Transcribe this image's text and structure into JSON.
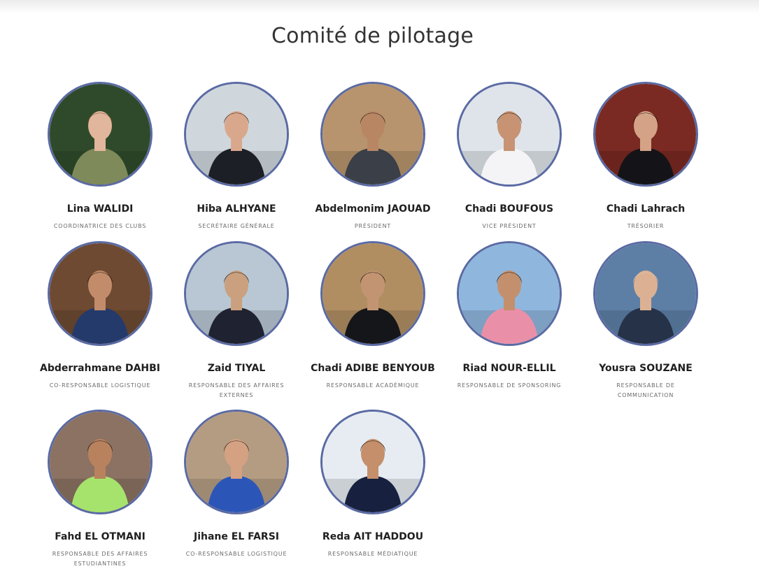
{
  "page": {
    "title": "Comité de pilotage"
  },
  "members": [
    {
      "name": "Lina WALIDI",
      "role": "COORDINATRICE DES CLUBS",
      "bg": "#2f4a2a",
      "shirt": "#7f8a5a",
      "hair": "#6b4a2e",
      "skin": "#e1b69c"
    },
    {
      "name": "Hiba ALHYANE",
      "role": "SECRÉTAIRE GÉNÉRALE",
      "bg": "#cfd7dc",
      "shirt": "#1d1f26",
      "hair": "#2a1b14",
      "skin": "#d9a88c"
    },
    {
      "name": "Abdelmonim JAOUAD",
      "role": "PRÉSIDENT",
      "bg": "#b7946d",
      "shirt": "#3a3f48",
      "hair": "#1c140f",
      "skin": "#b98664"
    },
    {
      "name": "Chadi BOUFOUS",
      "role": "VICE PRÉSIDENT",
      "bg": "#dfe4ea",
      "shirt": "#f4f4f6",
      "hair": "#1b130e",
      "skin": "#c79373"
    },
    {
      "name": "Chadi Lahrach",
      "role": "TRÉSORIER",
      "bg": "#7a2a22",
      "shirt": "#141418",
      "hair": "#1b130e",
      "skin": "#d4a286"
    },
    {
      "name": "Abderrahmane DAHBI",
      "role": "CO-RESPONSABLE LOGISTIQUE",
      "bg": "#6e4a33",
      "shirt": "#243a6a",
      "hair": "#1b130e",
      "skin": "#c28c6a"
    },
    {
      "name": "Zaid TIYAL",
      "role": "RESPONSABLE DES AFFAIRES EXTERNES",
      "bg": "#b8c7d3",
      "shirt": "#1f2230",
      "hair": "#1b130e",
      "skin": "#caa07e"
    },
    {
      "name": "Chadi ADIBE BENYOUB",
      "role": "RESPONSABLE ACADÉMIQUE",
      "bg": "#b08e62",
      "shirt": "#15161a",
      "hair": "#1b130e",
      "skin": "#c39472"
    },
    {
      "name": "Riad NOUR-ELLIL",
      "role": "RESPONSABLE DE SPONSORING",
      "bg": "#8fb6dd",
      "shirt": "#ea8fa8",
      "hair": "#1b130e",
      "skin": "#c48f6c"
    },
    {
      "name": "Yousra SOUZANE",
      "role": "RESPONSABLE DE COMMUNICATION",
      "bg": "#5d7fa6",
      "shirt": "#263248",
      "hair": "#e0c9ac",
      "skin": "#dcb193"
    },
    {
      "name": "Fahd EL OTMANI",
      "role": "RESPONSABLE DES AFFAIRES ESTUDIANTINES",
      "bg": "#8b7262",
      "shirt": "#a6e36c",
      "hair": "#1b130e",
      "skin": "#b9825e"
    },
    {
      "name": "Jihane EL FARSI",
      "role": "CO-RESPONSABLE LOGISTIQUE",
      "bg": "#b49c82",
      "shirt": "#2b56b8",
      "hair": "#2a1b14",
      "skin": "#d4a183"
    },
    {
      "name": "Reda AIT HADDOU",
      "role": "RESPONSABLE MÉDIATIQUE",
      "bg": "#e6ecf2",
      "shirt": "#17213f",
      "hair": "#1b130e",
      "skin": "#c58f6b"
    }
  ]
}
